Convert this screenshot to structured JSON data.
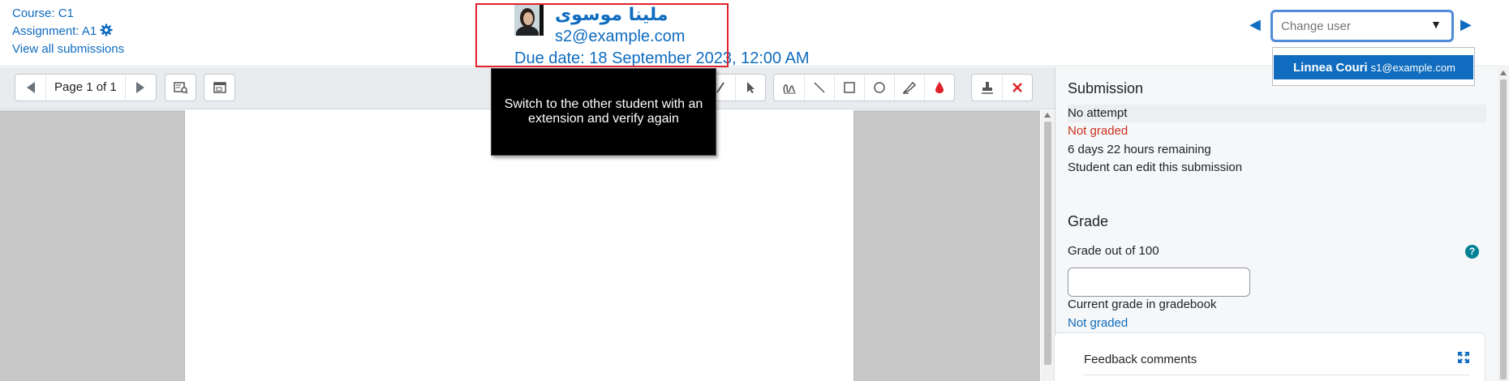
{
  "header": {
    "course_link": "Course: C1",
    "assignment_link": "Assignment: A1",
    "view_all_link": "View all submissions",
    "user_name": "ملينا موسوى",
    "user_email": "s2@example.com",
    "due_date": "Due date: 18 September 2023, 12:00 AM",
    "change_user_placeholder": "Change user",
    "dropdown_option_name": "Linnea Couri",
    "dropdown_option_email": "s1@example.com"
  },
  "toolbar": {
    "page_label": "Page 1 of 1"
  },
  "tooltip": {
    "text": "Switch to the other student with an extension and verify again"
  },
  "panel": {
    "submission_title": "Submission",
    "status_attempt": "No attempt",
    "status_grading": "Not graded",
    "status_time": "6 days 22 hours remaining",
    "status_edit": "Student can edit this submission",
    "grade_title": "Grade",
    "grade_label": "Grade out of 100",
    "current_grade_label": "Current grade in gradebook",
    "current_grade_value": "Not graded",
    "feedback_title": "Feedback comments"
  },
  "colors": {
    "link": "#0f6cbf",
    "highlight": "#e0222b",
    "not_graded": "#ca3120",
    "help": "#008196"
  },
  "icons": [
    "gear-icon",
    "prev-page-icon",
    "next-page-icon",
    "search-comments-icon",
    "expand-icon",
    "pen-icon",
    "select-icon",
    "comment-icon",
    "line-icon",
    "rectangle-icon",
    "oval-icon",
    "highlighter-icon",
    "colour-icon",
    "stamp-icon",
    "delete-icon",
    "help-icon",
    "fullscreen-icon"
  ]
}
